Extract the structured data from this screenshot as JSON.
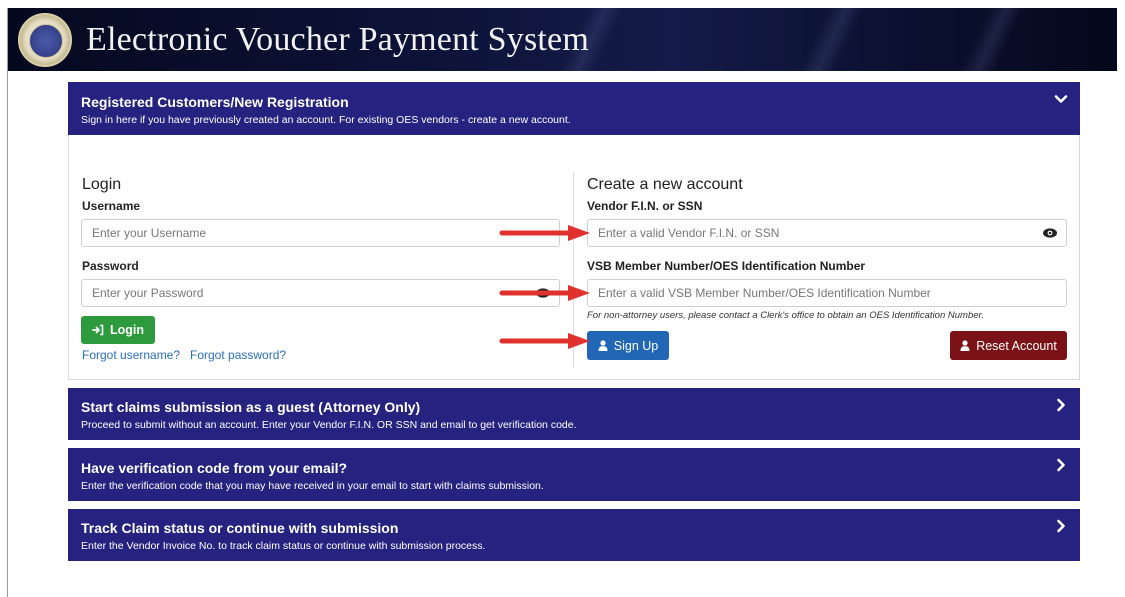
{
  "header": {
    "title": "Electronic Voucher Payment System"
  },
  "registered": {
    "title": "Registered Customers/New Registration",
    "subtitle": "Sign in here if you have previously created an account. For existing OES vendors - create a new account."
  },
  "login": {
    "heading": "Login",
    "username_label": "Username",
    "username_placeholder": "Enter your Username",
    "password_label": "Password",
    "password_placeholder": "Enter your Password",
    "login_button": "Login",
    "forgot_username": "Forgot username?",
    "forgot_password": "Forgot password?"
  },
  "create": {
    "heading": "Create a new account",
    "fin_label": "Vendor F.I.N. or SSN",
    "fin_placeholder": "Enter a valid Vendor F.I.N. or SSN",
    "vsb_label": "VSB Member Number/OES Identification Number",
    "vsb_placeholder": "Enter a valid VSB Member Number/OES Identification Number",
    "note": "For non-attorney users, please contact a Clerk's office to obtain an OES Identification Number.",
    "signup_button": "Sign Up",
    "reset_button": "Reset Account"
  },
  "guest": {
    "title": "Start claims submission as a guest (Attorney Only)",
    "subtitle": "Proceed to submit without an account. Enter your Vendor F.I.N. OR SSN and email to get verification code."
  },
  "verification": {
    "title": "Have verification code from your email?",
    "subtitle": "Enter the verification code that you may have received in your email to start with claims submission."
  },
  "track": {
    "title": "Track Claim status or continue with submission",
    "subtitle": "Enter the Vendor Invoice No. to track claim status or continue with submission process."
  },
  "colors": {
    "panel": "#25237f",
    "login_button": "#2e9a3e",
    "signup_button": "#2267b5",
    "reset_button": "#7a1217",
    "annotation_arrow": "#e0312f"
  }
}
